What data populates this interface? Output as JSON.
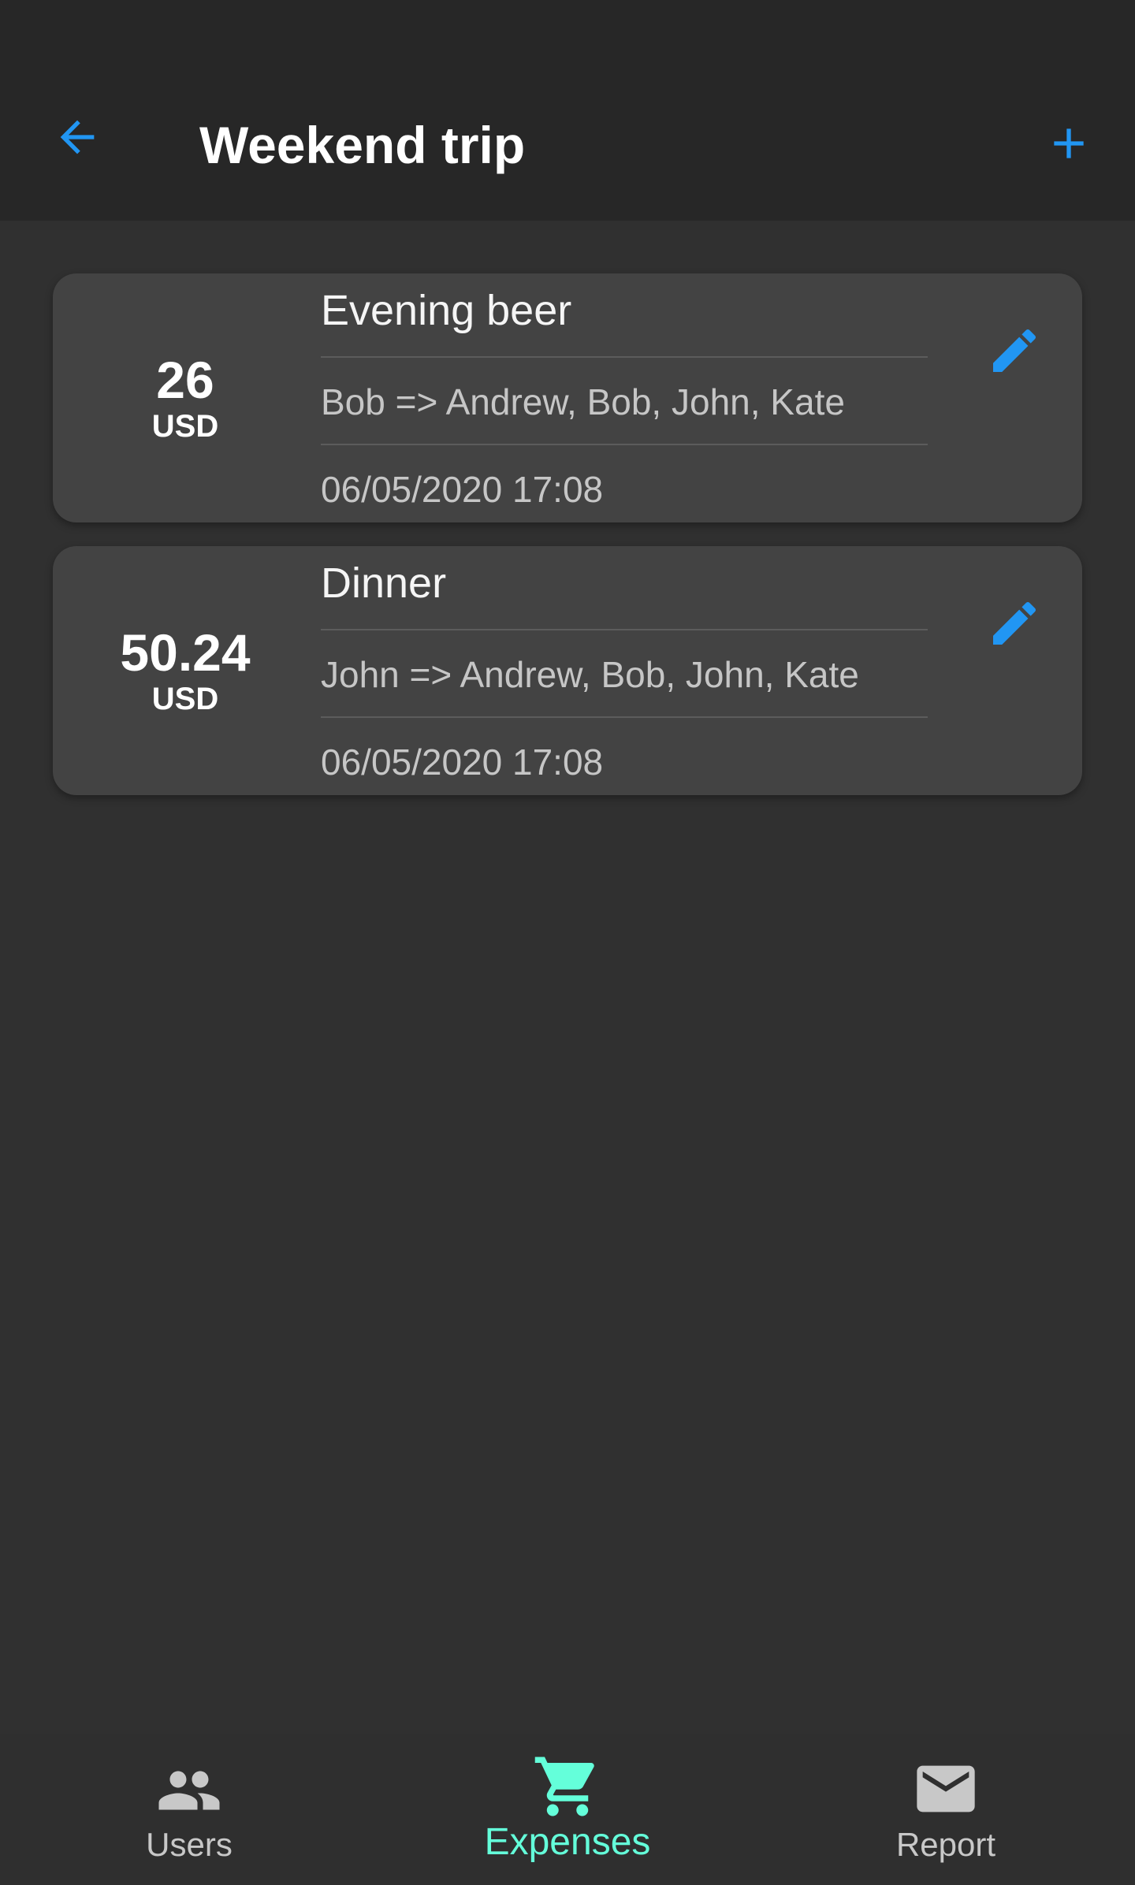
{
  "colors": {
    "accent": "#2196f3",
    "active_tab": "#64ffda",
    "inactive_tab": "#c8c8c8",
    "background": "#303030",
    "app_bar": "#272727",
    "card": "#434343"
  },
  "header": {
    "title": "Weekend trip",
    "back_icon": "arrow-left-icon",
    "add_icon": "plus-icon"
  },
  "expenses": [
    {
      "amount": "26",
      "currency": "USD",
      "name": "Evening beer",
      "split": "Bob => Andrew, Bob, John, Kate",
      "date": "06/05/2020 17:08",
      "edit_icon": "pencil-icon"
    },
    {
      "amount": "50.24",
      "currency": "USD",
      "name": "Dinner",
      "split": "John => Andrew, Bob, John, Kate",
      "date": "06/05/2020 17:08",
      "edit_icon": "pencil-icon"
    }
  ],
  "bottom_nav": {
    "items": [
      {
        "label": "Users",
        "icon": "people-icon",
        "active": false
      },
      {
        "label": "Expenses",
        "icon": "shopping-cart-icon",
        "active": true
      },
      {
        "label": "Report",
        "icon": "mail-icon",
        "active": false
      }
    ]
  }
}
